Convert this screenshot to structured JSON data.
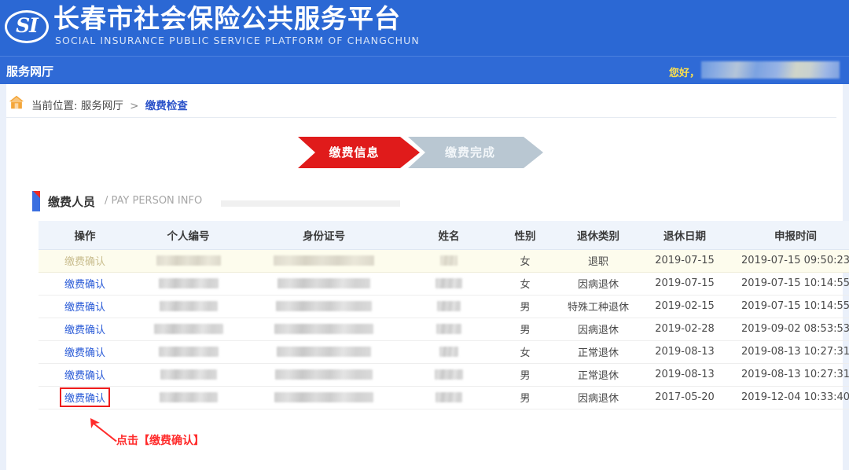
{
  "header": {
    "logo_text": "SI",
    "title_cn": "长春市社会保险公共服务平台",
    "title_en": "SOCIAL INSURANCE PUBLIC SERVICE PLATFORM OF CHANGCHUN",
    "subbar_title": "服务网厅",
    "greeting": "您好，"
  },
  "breadcrumb": {
    "prefix": "当前位置:",
    "root": "服务网厅",
    "separator": ">",
    "current": "缴费检查"
  },
  "steps": [
    {
      "label": "缴费信息",
      "state": "active",
      "color": "#e01b1b"
    },
    {
      "label": "缴费完成",
      "state": "inactive",
      "color": "#b9c7d2"
    }
  ],
  "section": {
    "title_cn": "缴费人员",
    "title_en": "/ PAY PERSON INFO"
  },
  "table": {
    "columns": [
      "操作",
      "个人编号",
      "身份证号",
      "姓名",
      "性别",
      "退休类别",
      "退休日期",
      "申报时间"
    ],
    "action_label": "缴费确认",
    "rows": [
      {
        "highlight": true,
        "boxed": false,
        "id_w": 82,
        "sid_w": 128,
        "name_w": 22,
        "gender": "女",
        "retire_type": "退职",
        "retire_date": "2019-07-15",
        "declare_time": "2019-07-15 09:50:23"
      },
      {
        "highlight": false,
        "boxed": false,
        "id_w": 76,
        "sid_w": 118,
        "name_w": 34,
        "gender": "女",
        "retire_type": "因病退休",
        "retire_date": "2019-07-15",
        "declare_time": "2019-07-15 10:14:55"
      },
      {
        "highlight": false,
        "boxed": false,
        "id_w": 74,
        "sid_w": 122,
        "name_w": 30,
        "gender": "男",
        "retire_type": "特殊工种退休",
        "retire_date": "2019-02-15",
        "declare_time": "2019-07-15 10:14:55"
      },
      {
        "highlight": false,
        "boxed": false,
        "id_w": 88,
        "sid_w": 126,
        "name_w": 32,
        "gender": "男",
        "retire_type": "因病退休",
        "retire_date": "2019-02-28",
        "declare_time": "2019-09-02 08:53:53"
      },
      {
        "highlight": false,
        "boxed": false,
        "id_w": 76,
        "sid_w": 120,
        "name_w": 24,
        "gender": "女",
        "retire_type": "正常退休",
        "retire_date": "2019-08-13",
        "declare_time": "2019-08-13 10:27:31"
      },
      {
        "highlight": false,
        "boxed": false,
        "id_w": 72,
        "sid_w": 124,
        "name_w": 36,
        "gender": "男",
        "retire_type": "正常退休",
        "retire_date": "2019-08-13",
        "declare_time": "2019-08-13 10:27:31"
      },
      {
        "highlight": false,
        "boxed": true,
        "id_w": 74,
        "sid_w": 126,
        "name_w": 34,
        "gender": "男",
        "retire_type": "因病退休",
        "retire_date": "2017-05-20",
        "declare_time": "2019-12-04 10:33:40"
      }
    ]
  },
  "annotation": {
    "text": "点击【缴费确认】",
    "color": "#ff2b2b"
  }
}
